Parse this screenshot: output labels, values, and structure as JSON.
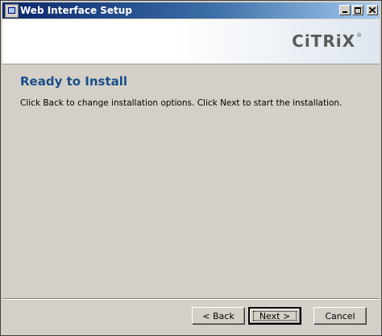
{
  "window": {
    "title": "Web Interface Setup",
    "icons": [
      "app-icon",
      "minimize-icon",
      "maximize-icon",
      "close-icon"
    ]
  },
  "header": {
    "logo_text": "CiTRiX",
    "logo_mark": "®"
  },
  "main": {
    "title": "Ready to Install",
    "description": "Click Back to change installation options. Click Next to start the installation."
  },
  "buttons": {
    "back_label": "< Back",
    "next_label": "Next >",
    "cancel_label": "Cancel"
  },
  "colors": {
    "title_accent": "#1a4f8a",
    "titlebar_start": "#0a246a",
    "titlebar_end": "#a6caf0",
    "dialog_bg": "#d4d0c8"
  }
}
